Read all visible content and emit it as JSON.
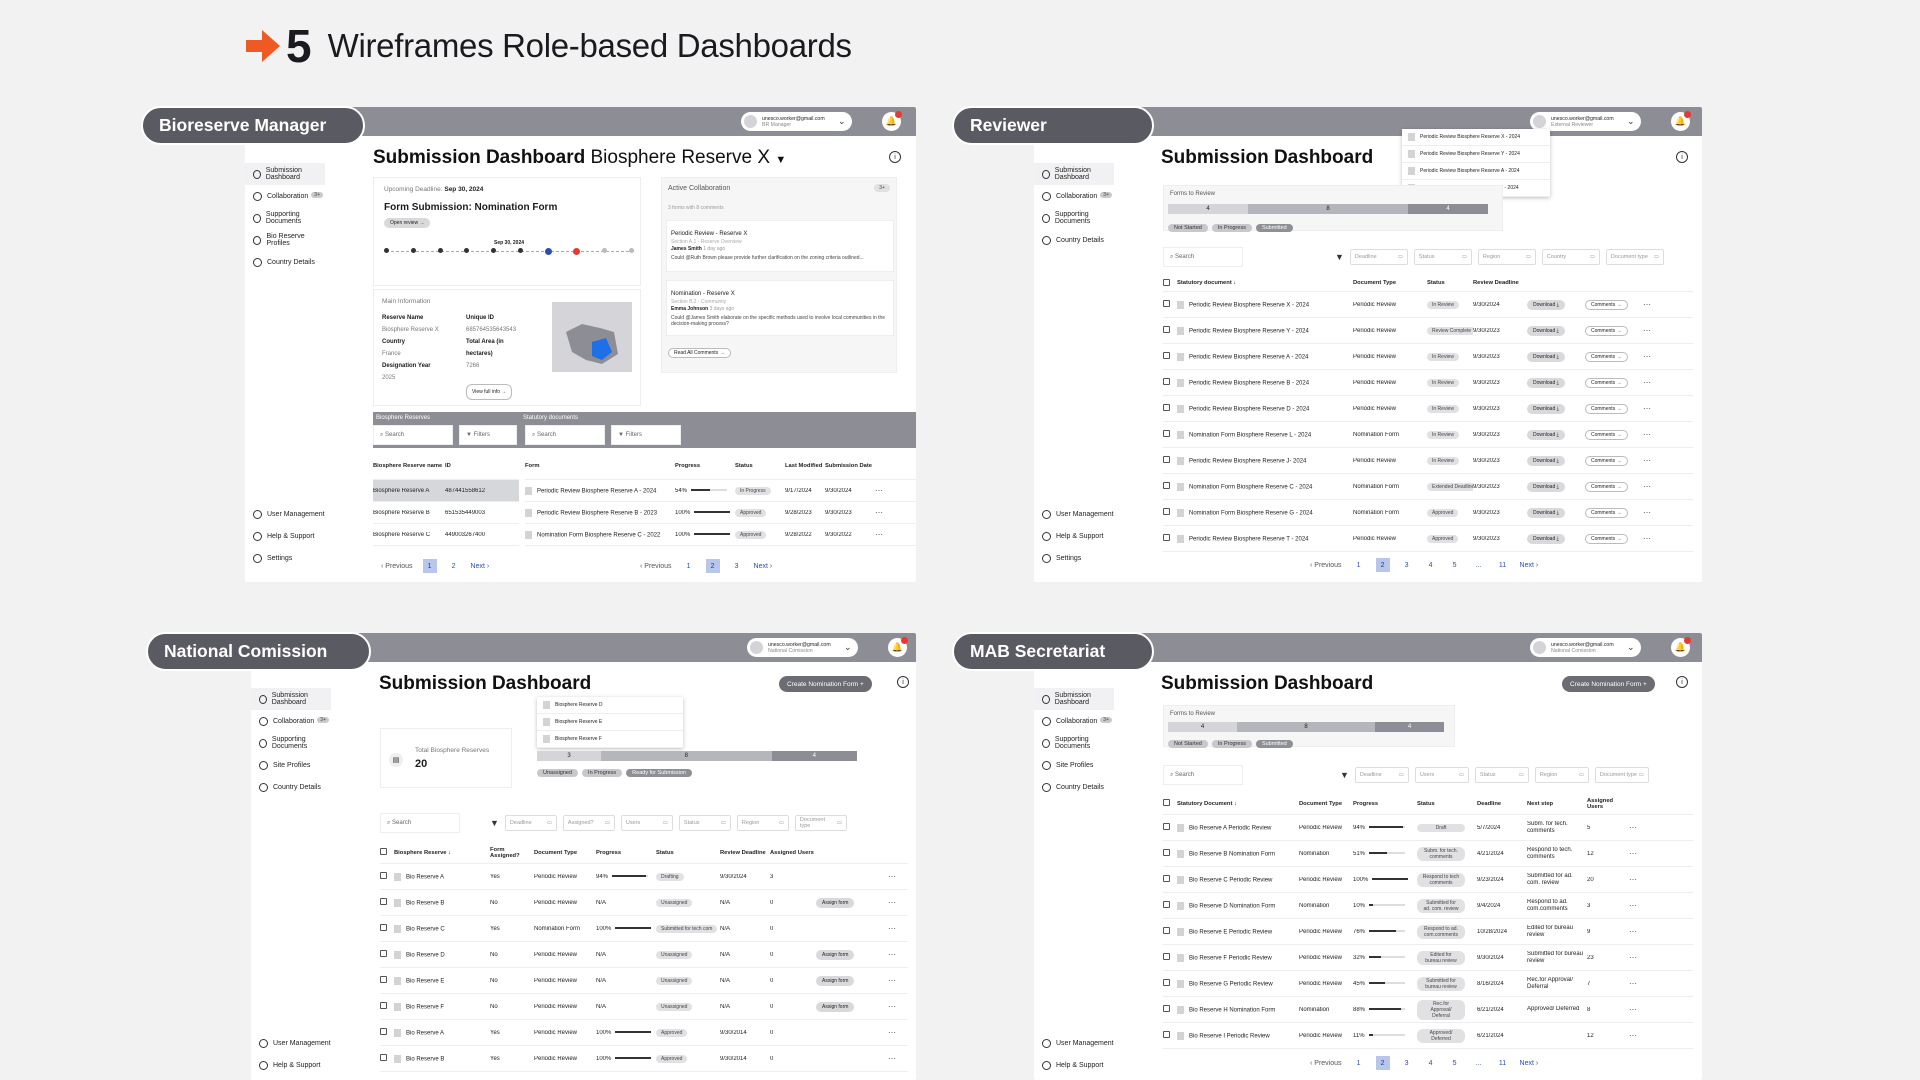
{
  "header": {
    "number": "5",
    "title": "Wireframes Role-based Dashboards"
  },
  "common": {
    "user_email": "unesco.worker@gmail.com",
    "dashboard_title": "Submission Dashboard",
    "nav": {
      "submission": "Submission Dashboard",
      "collab": "Collaboration",
      "supporting": "Supporting Documents",
      "bio_profiles": "Bio Reserve Profiles",
      "site_profiles": "Site Profiles",
      "country": "Country Details",
      "user_mgmt": "User Management",
      "help": "Help & Support",
      "settings": "Settings"
    },
    "collab_badge": "3+",
    "search": "Search",
    "filters": "Filters",
    "previous": "Previous",
    "next": "Next",
    "download": "Download ⤓",
    "comments": "Comments →",
    "assign": "Assign form",
    "create_btn": "Create Nomination Form +",
    "forms_to_review": "Forms to Review",
    "status_not_started": "Not Started",
    "status_in_progress": "In Progress",
    "status_submitted": "Submitted",
    "unassigned": "Unassigned",
    "ready": "Ready for Submission"
  },
  "bm": {
    "role": "Bioreserve Manager",
    "user_role": "BR Manager",
    "title_sub": "Biosphere Reserve X",
    "deadline_label": "Upcoming Deadline:",
    "deadline": "Sep 30, 2024",
    "form_title": "Form Submission: Nomination Form",
    "open_review": "Open review →",
    "steps_date": "Sep 30, 2024",
    "active_collab": "Active Collaboration",
    "collab_note": "3 forms with 8 comments",
    "c1_title": "Periodic Review - Reserve X",
    "c1_section": "Section A.1 - Reserve Overview",
    "c1_author": "James Smith",
    "c1_time": "1 day ago",
    "c1_text": "Could @Ruth Brown please provide further clarification on the zoning criteria outlined...",
    "c2_title": "Nomination - Reserve X",
    "c2_section": "Section B.2 - Community",
    "c2_author": "Emma Johnson",
    "c2_time": "3 days ago",
    "c2_text": "Could @James Smith elaborate on the specific methods used to involve local communities in the decision-making process?",
    "read_all": "Read All Comments →",
    "main_info": "Main Information",
    "reserve_name_l": "Reserve Name",
    "reserve_name": "Biosphere Reserve X",
    "uid_l": "Unique ID",
    "uid": "685764535643543",
    "country_l": "Country",
    "country": "France",
    "area_l": "Total Area (in hectares)",
    "area": "7266",
    "year_l": "Designation Year",
    "year": "2025",
    "view_full": "View full info →",
    "br_head": "Biosphere Reserves",
    "sd_head": "Statutory documents",
    "br_cols": [
      "Biosphere Reserve name",
      "ID"
    ],
    "br_rows": [
      [
        "Biosphere Reserve A",
        "487441558612"
      ],
      [
        "Biosphere Reserve B",
        "651535449003"
      ],
      [
        "Biosphere Reserve C",
        "449003267400"
      ]
    ],
    "sd_cols": [
      "Form",
      "Progress",
      "Status",
      "Last Modified",
      "Submission Date"
    ],
    "sd_rows": [
      [
        "Periodic Review Biosphere Reserve A - 2024",
        "54%",
        "In Progress",
        "9/17/2024",
        "9/30/2024"
      ],
      [
        "Periodic Review Biosphere Reserve B - 2023",
        "100%",
        "Approved",
        "9/28/2023",
        "9/30/2023"
      ],
      [
        "Nomination Form Biosphere Reserve C - 2022",
        "100%",
        "Approved",
        "9/28/2022",
        "9/30/2022"
      ]
    ],
    "pages_left": [
      "1",
      "2"
    ],
    "pages_right": [
      "1",
      "2",
      "3"
    ]
  },
  "rv": {
    "role": "Reviewer",
    "user_role": "External Reviewer",
    "dropdown": [
      "Periodic Review Biosphere Reserve X - 2024",
      "Periodic Review Biosphere Reserve Y - 2024",
      "Periodic Review Biosphere Reserve A - 2024",
      "Periodic Review Biosphere ReserveB - 2024"
    ],
    "seg": [
      "4",
      "8",
      "4"
    ],
    "filters": [
      "Deadline",
      "Status",
      "Region",
      "Country",
      "Document type"
    ],
    "cols": [
      "Statutory document ↓",
      "Document Type",
      "Status",
      "Review Deadline"
    ],
    "rows": [
      [
        "Periodic Review Biosphere Reserve X - 2024",
        "Periodic Review",
        "In Review",
        "9/30/2024"
      ],
      [
        "Periodic Review Biosphere Reserve Y - 2024",
        "Periodic Review",
        "Review Complete",
        "9/30/2023"
      ],
      [
        "Periodic Review Biosphere Reserve A - 2024",
        "Periodic Review",
        "In Review",
        "9/30/2023"
      ],
      [
        "Periodic Review Biosphere Reserve B - 2024",
        "Periodic Review",
        "In Review",
        "9/30/2023"
      ],
      [
        "Periodic Review Biosphere Reserve D - 2024",
        "Periodic Review",
        "In Review",
        "9/30/2023"
      ],
      [
        "Nomination Form Biosphere Reserve L - 2024",
        "Nomination Form",
        "In Review",
        "9/30/2023"
      ],
      [
        "Periodic Review Biosphere Reserve J- 2024",
        "Periodic Review",
        "In Review",
        "9/30/2023"
      ],
      [
        "Nomination Form Biosphere Reserve C - 2024",
        "Nomination Form",
        "Extended Deadline",
        "9/30/2023"
      ],
      [
        "Nomination Form Biosphere Reserve G - 2024",
        "Nomination Form",
        "Approved",
        "9/30/2023"
      ],
      [
        "Periodic Review Biosphere Reserve T - 2024",
        "Periodic Review",
        "Approved",
        "9/30/2023"
      ]
    ],
    "pages": [
      "1",
      "2",
      "3",
      "4",
      "5",
      "...",
      "11"
    ]
  },
  "nc": {
    "role": "National Comission",
    "user_role": "National Comission",
    "total_label": "Total Biosphere Reserves",
    "total": "20",
    "dropdown": [
      "Biosphere Reserve D",
      "Biosphere Reserve E",
      "Biosphere Reserve F"
    ],
    "seg": [
      "3",
      "8",
      "4"
    ],
    "filters": [
      "Deadline",
      "Assigned?",
      "Users",
      "Status",
      "Region",
      "Document type"
    ],
    "cols": [
      "Biosphere Reserve ↓",
      "Form Assigned?",
      "Document Type",
      "Progress",
      "Status",
      "Review Deadline",
      "Assigned Users"
    ],
    "rows": [
      [
        "Bio Reserve A",
        "Yes",
        "Periodic Review",
        "94%",
        "Drafting",
        "9/30/2024",
        "3",
        ""
      ],
      [
        "Bio Reserve B",
        "No",
        "Periodic Review",
        "N/A",
        "Unassigned",
        "N/A",
        "0",
        "assign"
      ],
      [
        "Bio Reserve C",
        "Yes",
        "Nomination Form",
        "100%",
        "Submitted for tech com",
        "N/A",
        "0",
        ""
      ],
      [
        "Bio Reserve D",
        "No",
        "Periodic Review",
        "N/A",
        "Unassigned",
        "N/A",
        "0",
        "assign"
      ],
      [
        "Bio Reserve E",
        "No",
        "Periodic Review",
        "N/A",
        "Unassigned",
        "N/A",
        "0",
        "assign"
      ],
      [
        "Bio Reserve F",
        "No",
        "Periodic Review",
        "N/A",
        "Unassigned",
        "N/A",
        "0",
        "assign"
      ],
      [
        "Bio Reserve A",
        "Yes",
        "Periodic Review",
        "100%",
        "Approved",
        "9/30/2014",
        "0",
        ""
      ],
      [
        "Bio Reserve B",
        "Yes",
        "Periodic Review",
        "100%",
        "Approved",
        "9/30/2014",
        "0",
        ""
      ]
    ]
  },
  "ms": {
    "role": "MAB Secretariat",
    "user_role": "National Comission",
    "seg": [
      "4",
      "8",
      "4"
    ],
    "filters": [
      "Deadline",
      "Users",
      "Status",
      "Region",
      "Document type"
    ],
    "cols": [
      "Statutory Document ↓",
      "Document Type",
      "Progress",
      "Status",
      "Deadline",
      "Next step",
      "Assigned Users"
    ],
    "rows": [
      [
        "Bio Reserve A Periodic Review",
        "Periodic Review",
        "94%",
        "Draft",
        "5/7/2024",
        "Subm. for tech. comments",
        "5"
      ],
      [
        "Bio Reserve B Nomination Form",
        "Nomination",
        "51%",
        "Subm. for tech. comments",
        "4/21/2024",
        "Respond to tech. comments",
        "12"
      ],
      [
        "Bio Reserve C Periodic Review",
        "Periodic Review",
        "100%",
        "Respond to tech comments",
        "9/23/2024",
        "Submitted for ad. com. review",
        "20"
      ],
      [
        "Bio Reserve D Nomination Form",
        "Nomination",
        "10%",
        "Submitted for ad. com. review",
        "9/4/2024",
        "Respond to ad. com.comments",
        "3"
      ],
      [
        "Bio Reserve E Periodic Review",
        "Periodic Review",
        "76%",
        "Respond to ad. com.comments",
        "10/28/2024",
        "Edited for bureau review",
        "9"
      ],
      [
        "Bio Reserve F Periodic Review",
        "Periodic Review",
        "32%",
        "Edited for bureau review",
        "9/30/2024",
        "Submitted for bureau review",
        "23"
      ],
      [
        "Bio Reserve G Periodic Review",
        "Periodic Review",
        "45%",
        "Submitted for bureau review",
        "8/16/2024",
        "Rec.for Approval/ Deferral",
        "7"
      ],
      [
        "Bio Reserve H Nomination Form",
        "Nomination",
        "88%",
        "Rec.for Approval/ Deferral",
        "6/21/2024",
        "Approved/ Deferred",
        "8"
      ],
      [
        "Bio Reserve I Periodic Review",
        "Periodic Review",
        "11%",
        "Approved/ Deferred",
        "6/21/2024",
        "",
        "12"
      ]
    ],
    "pages": [
      "1",
      "2",
      "3",
      "4",
      "5",
      "...",
      "11"
    ]
  }
}
